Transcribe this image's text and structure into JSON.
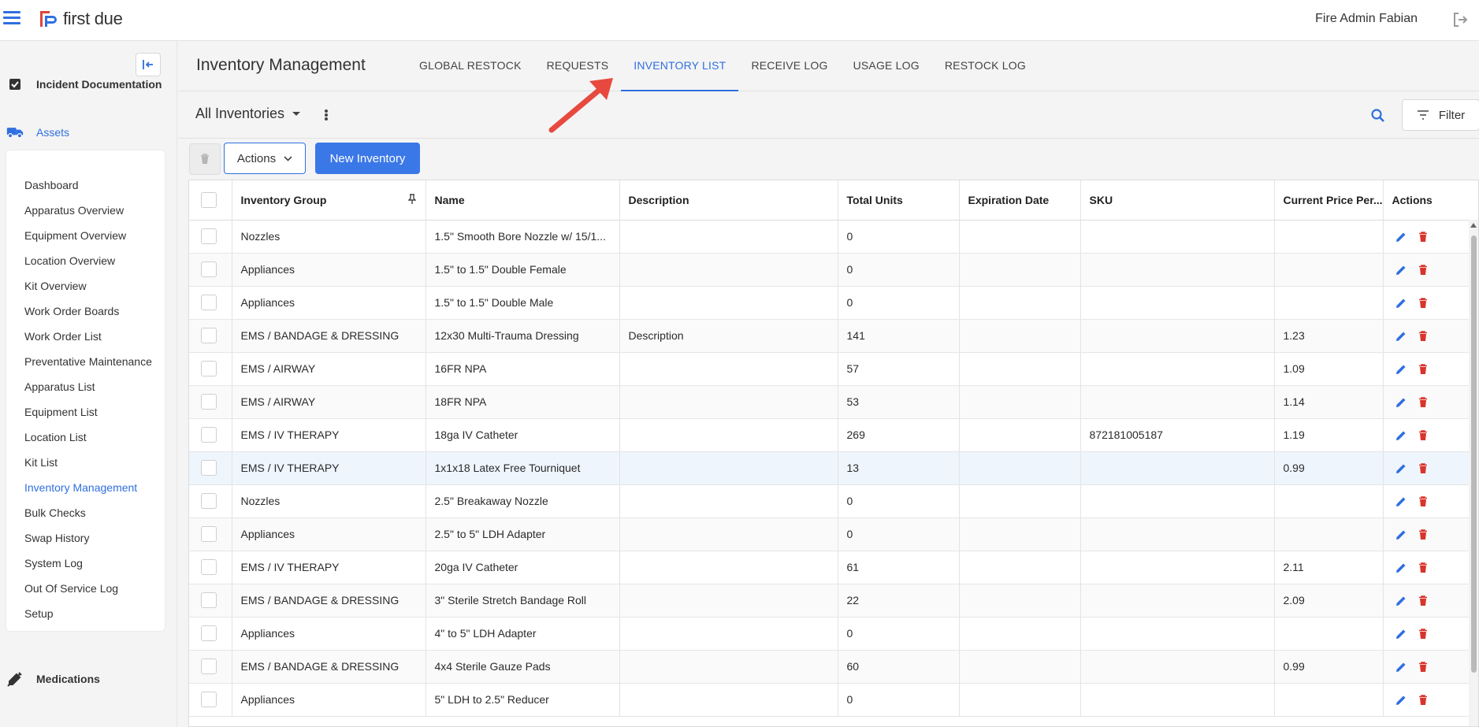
{
  "header": {
    "app_name": "first due",
    "user_name": "Fire Admin Fabian"
  },
  "sidebar": {
    "section_incident": "Incident Documentation",
    "section_assets": "Assets",
    "section_medications": "Medications",
    "items": [
      {
        "label": "Dashboard"
      },
      {
        "label": "Apparatus Overview"
      },
      {
        "label": "Equipment Overview"
      },
      {
        "label": "Location Overview"
      },
      {
        "label": "Kit Overview"
      },
      {
        "label": "Work Order Boards"
      },
      {
        "label": "Work Order List"
      },
      {
        "label": "Preventative Maintenance"
      },
      {
        "label": "Apparatus List"
      },
      {
        "label": "Equipment List"
      },
      {
        "label": "Location List"
      },
      {
        "label": "Kit List"
      },
      {
        "label": "Inventory Management"
      },
      {
        "label": "Bulk Checks"
      },
      {
        "label": "Swap History"
      },
      {
        "label": "System Log"
      },
      {
        "label": "Out Of Service Log"
      },
      {
        "label": "Setup"
      }
    ],
    "active_item": "Inventory Management"
  },
  "page": {
    "title": "Inventory Management",
    "tabs": [
      {
        "label": "GLOBAL RESTOCK"
      },
      {
        "label": "REQUESTS"
      },
      {
        "label": "INVENTORY LIST"
      },
      {
        "label": "RECEIVE LOG"
      },
      {
        "label": "USAGE LOG"
      },
      {
        "label": "RESTOCK LOG"
      }
    ],
    "active_tab": "INVENTORY LIST",
    "inventory_select": "All Inventories",
    "filter_label": "Filter",
    "actions_label": "Actions",
    "new_inventory_label": "New Inventory"
  },
  "table": {
    "columns": [
      "Inventory Group",
      "Name",
      "Description",
      "Total Units",
      "Expiration Date",
      "SKU",
      "Current Price Per...",
      "Actions"
    ],
    "rows": [
      {
        "group": "Nozzles",
        "name": "1.5\" Smooth Bore Nozzle w/ 15/1...",
        "description": "",
        "units": "0",
        "expiration": "",
        "sku": "",
        "price": ""
      },
      {
        "group": "Appliances",
        "name": "1.5\" to 1.5\" Double Female",
        "description": "",
        "units": "0",
        "expiration": "",
        "sku": "",
        "price": ""
      },
      {
        "group": "Appliances",
        "name": "1.5\" to 1.5\" Double Male",
        "description": "",
        "units": "0",
        "expiration": "",
        "sku": "",
        "price": ""
      },
      {
        "group": "EMS / BANDAGE & DRESSING",
        "name": "12x30 Multi-Trauma Dressing",
        "description": "Description",
        "units": "141",
        "expiration": "",
        "sku": "",
        "price": "1.23"
      },
      {
        "group": "EMS / AIRWAY",
        "name": "16FR NPA",
        "description": "",
        "units": "57",
        "expiration": "",
        "sku": "",
        "price": "1.09"
      },
      {
        "group": "EMS / AIRWAY",
        "name": "18FR NPA",
        "description": "",
        "units": "53",
        "expiration": "",
        "sku": "",
        "price": "1.14"
      },
      {
        "group": "EMS / IV THERAPY",
        "name": "18ga IV Catheter",
        "description": "",
        "units": "269",
        "expiration": "",
        "sku": "872181005187",
        "price": "1.19"
      },
      {
        "group": "EMS / IV THERAPY",
        "name": "1x1x18 Latex Free Tourniquet",
        "description": "",
        "units": "13",
        "expiration": "",
        "sku": "",
        "price": "0.99"
      },
      {
        "group": "Nozzles",
        "name": "2.5\" Breakaway Nozzle",
        "description": "",
        "units": "0",
        "expiration": "",
        "sku": "",
        "price": ""
      },
      {
        "group": "Appliances",
        "name": "2.5\" to 5\" LDH Adapter",
        "description": "",
        "units": "0",
        "expiration": "",
        "sku": "",
        "price": ""
      },
      {
        "group": "EMS / IV THERAPY",
        "name": "20ga IV Catheter",
        "description": "",
        "units": "61",
        "expiration": "",
        "sku": "",
        "price": "2.11"
      },
      {
        "group": "EMS / BANDAGE & DRESSING",
        "name": "3\" Sterile Stretch Bandage Roll",
        "description": "",
        "units": "22",
        "expiration": "",
        "sku": "",
        "price": "2.09"
      },
      {
        "group": "Appliances",
        "name": "4\" to 5\" LDH Adapter",
        "description": "",
        "units": "0",
        "expiration": "",
        "sku": "",
        "price": ""
      },
      {
        "group": "EMS / BANDAGE & DRESSING",
        "name": "4x4 Sterile Gauze Pads",
        "description": "",
        "units": "60",
        "expiration": "",
        "sku": "",
        "price": "0.99"
      },
      {
        "group": "Appliances",
        "name": "5\" LDH to 2.5\" Reducer",
        "description": "",
        "units": "0",
        "expiration": "",
        "sku": "",
        "price": ""
      }
    ],
    "highlight_row": 7
  },
  "colors": {
    "accent": "#2f6fe0",
    "button_primary": "#3b78e7",
    "delete_red": "#d9342b",
    "annotation_arrow": "#e8493f"
  },
  "icons": [
    "hamburger-icon",
    "logo-icon",
    "logout-icon",
    "collapse-sidebar-icon",
    "check-square-icon",
    "truck-icon",
    "syringe-icon",
    "search-icon",
    "filter-icon",
    "trash-icon",
    "chevron-down-icon",
    "pin-icon",
    "edit-icon",
    "delete-icon"
  ]
}
